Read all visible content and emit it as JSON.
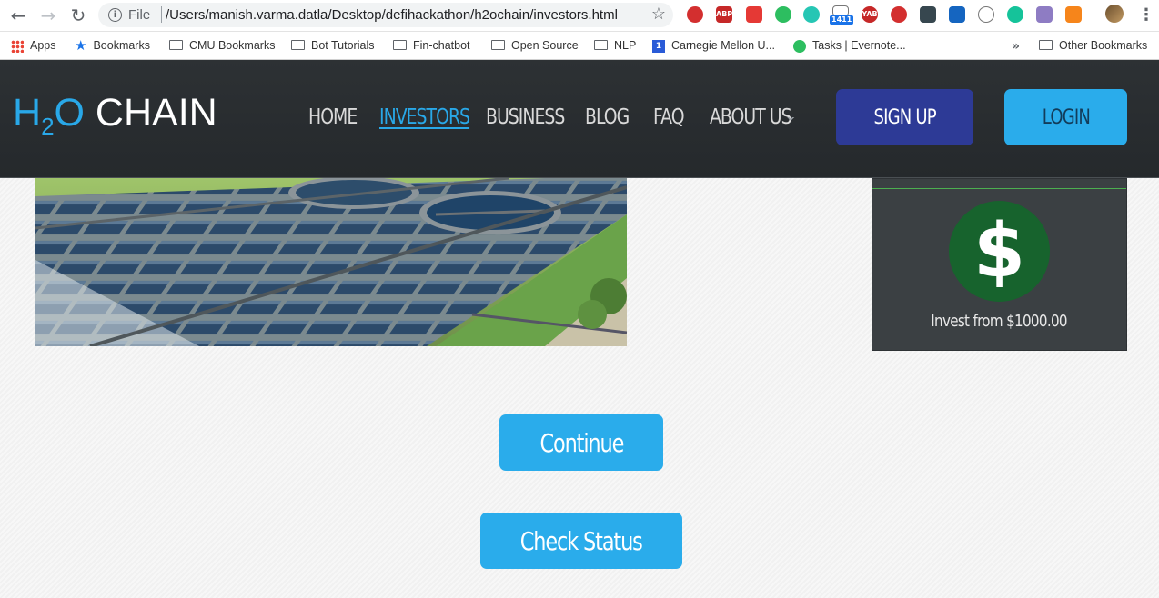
{
  "browser": {
    "address_scheme": "File",
    "address_url": "/Users/manish.varma.datla/Desktop/defihackathon/h2ochain/investors.html",
    "mail_badge": "1411",
    "extension_labels": {
      "abp": "ABP",
      "yab": "YAB"
    },
    "bookmarks": [
      "Apps",
      "Bookmarks",
      "CMU Bookmarks",
      "Bot Tutorials",
      "Fin-chatbot",
      "Open Source",
      "NLP",
      "Carnegie Mellon U...",
      "Tasks | Evernote..."
    ],
    "cmu_icon_text": "1",
    "more_bookmarks_glyph": "»",
    "other_bookmarks": "Other Bookmarks",
    "icons": [
      "back-icon",
      "forward-icon",
      "reload-icon",
      "info-icon",
      "star-icon",
      "menu-icon"
    ]
  },
  "site": {
    "logo": {
      "h": "H",
      "sub": "2",
      "o": "O",
      "rest": " CHAIN"
    },
    "nav": [
      "HOME",
      "INVESTORS",
      "BUSINESS",
      "BLOG",
      "FAQ",
      "ABOUT US"
    ],
    "active_nav": "INVESTORS",
    "signup_label": "SIGN UP",
    "login_label": "LOGIN",
    "invest_card": {
      "symbol": "$",
      "text": "Invest from $1000.00"
    },
    "continue_label": "Continue",
    "check_status_label": "Check Status",
    "colors": {
      "accent": "#29a8e8",
      "signup": "#2d3a96",
      "header": "#2b2f32",
      "card": "#3b4043",
      "dollar_bg": "#17632d"
    }
  }
}
